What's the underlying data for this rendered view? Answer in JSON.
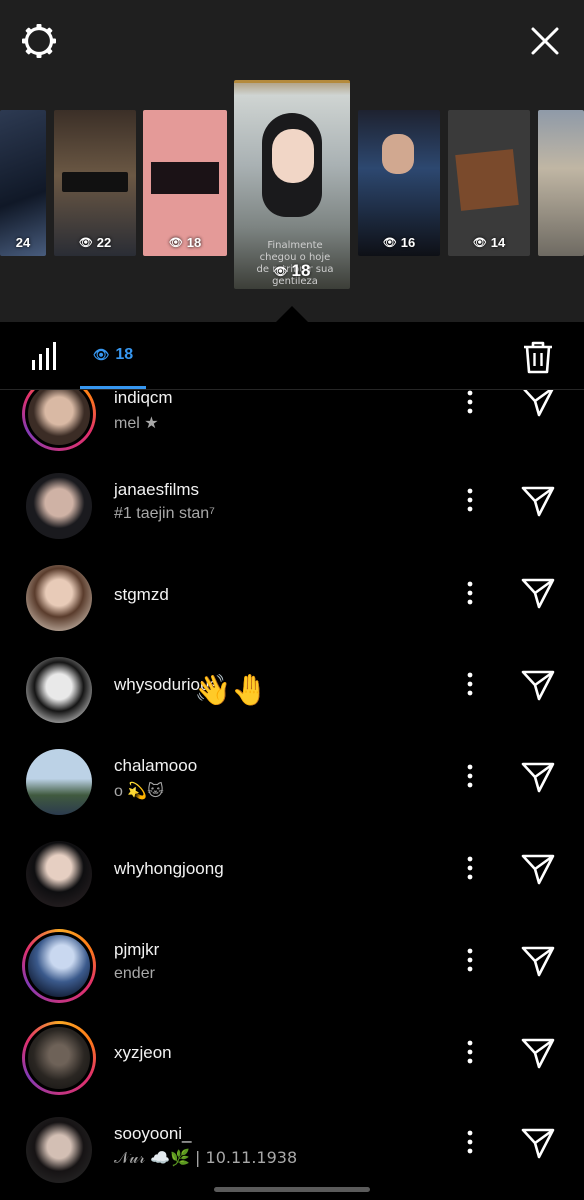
{
  "story_strip": {
    "thumbnails": [
      {
        "count": "24"
      },
      {
        "count": "22"
      },
      {
        "count": "18"
      },
      {
        "count": "18",
        "caption": "Finalmente chegou o hoje de retribuir sua gentileza"
      },
      {
        "count": "16"
      },
      {
        "count": "14"
      },
      {
        "count": ""
      }
    ]
  },
  "tabs": {
    "viewers_count": "18"
  },
  "viewers": [
    {
      "username": "indiqcm",
      "bio": "mel ★"
    },
    {
      "username": "janaesfilms",
      "bio": "#1 taejin stan⁷"
    },
    {
      "username": "stgmzd",
      "bio": ""
    },
    {
      "username": "whysodurious",
      "bio": ""
    },
    {
      "username": "chalamooo",
      "bio": "o 💫🐱"
    },
    {
      "username": "whyhongjoong",
      "bio": ""
    },
    {
      "username": "pjmjkr",
      "bio": "ender"
    },
    {
      "username": "xyzjeon",
      "bio": ""
    },
    {
      "username": "sooyooni_",
      "bio": "𝒩𝓊𝓇 ☁️🌿 | 10.11.1938"
    }
  ],
  "reaction": "👋🤚",
  "icons": {
    "settings": "settings-gear-icon",
    "close": "close-icon",
    "stats": "bar-chart-icon",
    "eye": "eye-icon",
    "trash": "trash-icon",
    "more": "more-vertical-icon",
    "send": "send-paper-plane-icon"
  },
  "colors": {
    "accent": "#3797f0",
    "background": "#000000",
    "strip_background": "#1f1f1f",
    "secondary_text": "#a8a8a8"
  }
}
